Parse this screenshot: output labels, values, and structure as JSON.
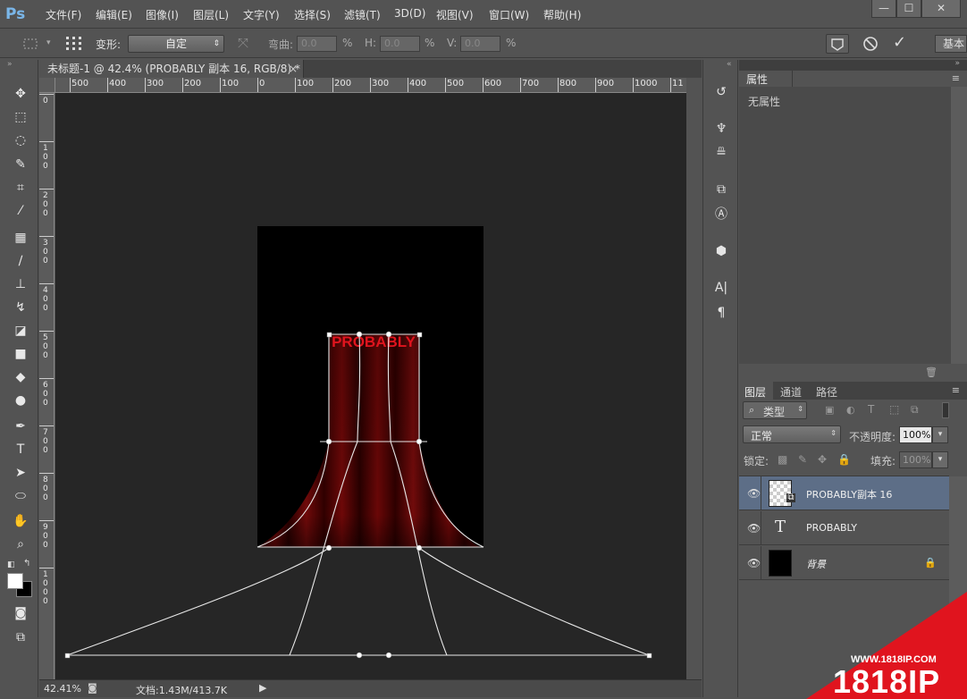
{
  "app": {
    "logo": "Ps"
  },
  "menu": [
    "文件(F)",
    "编辑(E)",
    "图像(I)",
    "图层(L)",
    "文字(Y)",
    "选择(S)",
    "滤镜(T)",
    "3D(D)",
    "视图(V)",
    "窗口(W)",
    "帮助(H)"
  ],
  "window_controls": {
    "minimize": "—",
    "maximize": "☐",
    "close": "✕"
  },
  "options": {
    "transform_label": "变形:",
    "transform_value": "自定",
    "bend_label": "弯曲:",
    "bend_value": "0.0",
    "h_label": "H:",
    "h_value": "0.0",
    "v_label": "V:",
    "v_value": "0.0",
    "percent": "%",
    "workspace": "基本"
  },
  "document": {
    "tab_title": "未标题-1 @ 42.4% (PROBABLY 副本 16, RGB/8) *",
    "close": "×",
    "canvas_text": "PROBABLY"
  },
  "rulers": {
    "h_ticks": [
      "500",
      "400",
      "300",
      "200",
      "100",
      "0",
      "100",
      "200",
      "300",
      "400",
      "500",
      "600",
      "700",
      "800",
      "900",
      "1000",
      "11"
    ],
    "v_ticks": [
      "0",
      "100",
      "200",
      "300",
      "400",
      "500",
      "600",
      "700",
      "800",
      "900",
      "1000"
    ]
  },
  "status": {
    "zoom": "42.41%",
    "doc_info": "文档:1.43M/413.7K"
  },
  "properties": {
    "tab": "属性",
    "empty_text": "无属性"
  },
  "layers_panel": {
    "tabs": [
      "图层",
      "通道",
      "路径"
    ],
    "filter_kind": "类型",
    "blend_mode": "正常",
    "opacity_label": "不透明度:",
    "opacity_value": "100%",
    "lock_label": "锁定:",
    "fill_label": "填充:",
    "fill_value": "100%",
    "layers": [
      {
        "name": "PROBABLY副本  16",
        "selected": true,
        "type": "smart"
      },
      {
        "name": "PROBABLY",
        "selected": false,
        "type": "text"
      },
      {
        "name": "背景",
        "selected": false,
        "type": "background",
        "locked": true
      }
    ]
  },
  "watermark": {
    "url": "WWW.1818IP.COM",
    "brand": "1818IP"
  },
  "colors": {
    "accent_red": "#e0141e",
    "selection_blue": "#5d6e87",
    "panel_bg": "#535353",
    "canvas_bg": "#262626"
  }
}
